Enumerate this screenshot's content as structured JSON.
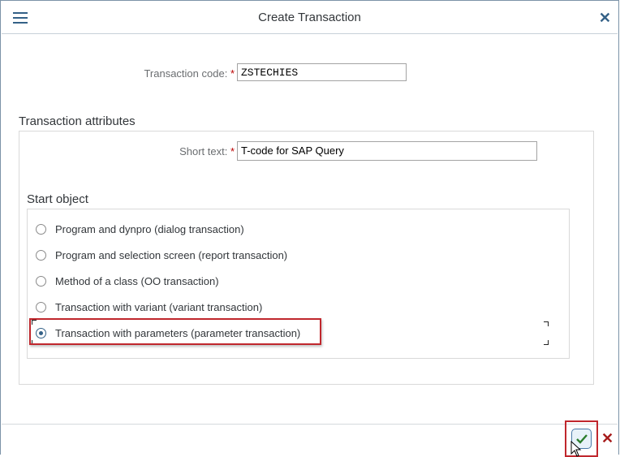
{
  "header": {
    "title": "Create Transaction",
    "menu_icon": "hamburger-menu-icon",
    "close_icon": "close-icon"
  },
  "transaction_code": {
    "label": "Transaction code:",
    "required_marker": "*",
    "value": "ZSTECHIES"
  },
  "attributes": {
    "title": "Transaction attributes",
    "short_text": {
      "label": "Short text:",
      "required_marker": "*",
      "value": "T-code for SAP Query"
    }
  },
  "start_object": {
    "title": "Start object",
    "options": [
      {
        "label": "Program and dynpro (dialog transaction)",
        "selected": false
      },
      {
        "label": "Program and selection screen (report transaction)",
        "selected": false
      },
      {
        "label": "Method of a class (OO transaction)",
        "selected": false
      },
      {
        "label": "Transaction with variant (variant transaction)",
        "selected": false
      },
      {
        "label": "Transaction with parameters (parameter transaction)",
        "selected": true
      }
    ]
  },
  "footer": {
    "ok_icon": "checkmark-icon",
    "cancel_icon": "cancel-x-icon",
    "ok_color": "#2b7d2b",
    "cancel_color": "#a61b1b"
  },
  "annotations": {
    "highlight_color": "#c0272d"
  }
}
